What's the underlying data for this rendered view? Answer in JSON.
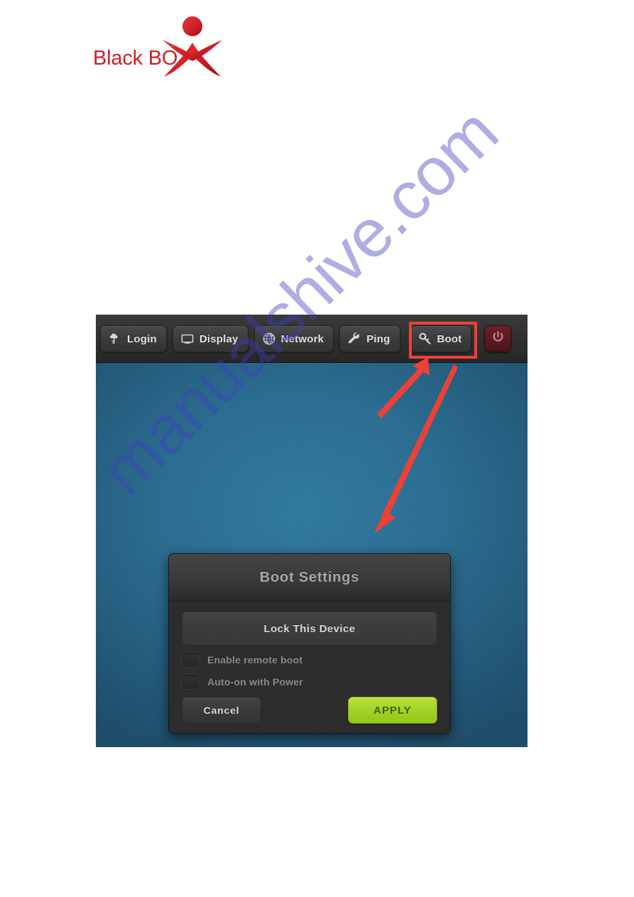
{
  "brand": {
    "name": "Black BOX",
    "visible_text": "Black BO",
    "logo_icon": "blackbox-person-logo",
    "color": "#cf1f26"
  },
  "watermark": {
    "text": "manualshive.com",
    "color": "#3e3ebe"
  },
  "screenshot": {
    "toolbar": {
      "buttons": [
        {
          "label": "Login",
          "icon": "cloud-key-icon",
          "name": "tab-login"
        },
        {
          "label": "Display",
          "icon": "monitor-icon",
          "name": "tab-display"
        },
        {
          "label": "Network",
          "icon": "globe-icon",
          "name": "tab-network"
        },
        {
          "label": "Ping",
          "icon": "wrench-icon",
          "name": "tab-ping"
        },
        {
          "label": "Boot",
          "icon": "key-icon",
          "name": "tab-boot"
        }
      ],
      "power_button": {
        "icon": "power-icon",
        "label": ""
      },
      "highlight": {
        "target": "Boot",
        "color": "#ef4036"
      }
    },
    "annotations": {
      "arrow_color": "#ef4036",
      "arrows": [
        {
          "name": "arrow-to-boot-tab",
          "direction": "up-right"
        },
        {
          "name": "arrow-to-dialog",
          "direction": "down-left"
        }
      ]
    },
    "dialog": {
      "title": "Boot Settings",
      "lock_button": "Lock This Device",
      "checkboxes": [
        {
          "label": "Enable remote boot",
          "checked": false
        },
        {
          "label": "Auto-on with Power",
          "checked": false
        }
      ],
      "cancel_label": "Cancel",
      "apply_label": "APPLY",
      "apply_color": "#a4d225"
    }
  }
}
